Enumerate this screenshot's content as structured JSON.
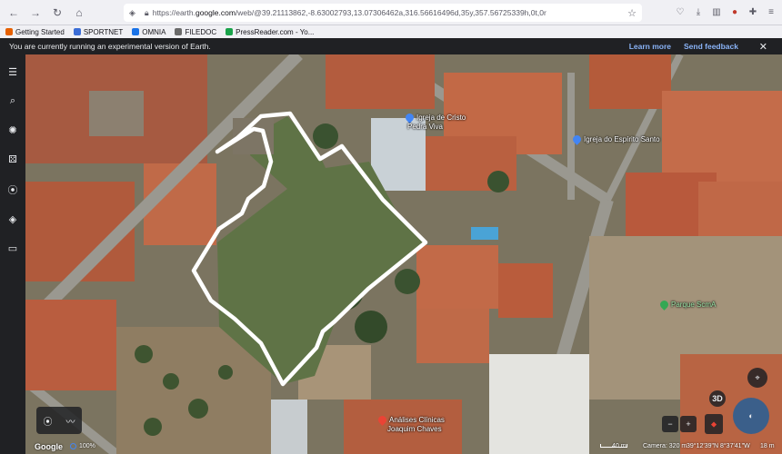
{
  "browser": {
    "url_prefix": "https://earth.",
    "url_host": "google.com",
    "url_rest": "/web/@39.21113862,-8.63002793,13.07306462a,316.56616496d,35y,357.56725339h,0t,0r",
    "bookmarks": [
      {
        "label": "Getting Started",
        "color": "#e66000"
      },
      {
        "label": "SPORTNET",
        "color": "#3b6dd6"
      },
      {
        "label": "OMNIA",
        "color": "#1a73e8"
      },
      {
        "label": "FILEDOC",
        "color": "#6a6a6a"
      },
      {
        "label": "PressReader.com - Yo...",
        "color": "#1aa34a"
      }
    ]
  },
  "banner": {
    "message": "You are currently running an experimental version of Earth.",
    "learn_more": "Learn more",
    "send_feedback": "Send feedback"
  },
  "sidebar": {
    "icons": [
      "menu-icon",
      "search-icon",
      "voyager-icon",
      "dice-icon",
      "pin-icon",
      "layers-icon",
      "ruler-icon"
    ]
  },
  "map": {
    "labels": [
      {
        "text": "Igreja de Cristo",
        "kind": "place"
      },
      {
        "text": "Pedra Viva",
        "kind": "place"
      },
      {
        "text": "Igreja do Espírito Santo",
        "kind": "place"
      },
      {
        "text": "Parque ScmA",
        "kind": "park"
      },
      {
        "text": "Análises Clínicas",
        "kind": "health"
      },
      {
        "text": "Joaquim Chaves",
        "kind": "health"
      }
    ]
  },
  "status": {
    "logo": "Google",
    "zoom": "100%",
    "scale": "40 m",
    "camera": "Camera: 320 m",
    "coords": "39°12'39\"N 8°37'41\"W",
    "elevation": "18 m"
  },
  "controls": {
    "three_d": "3D",
    "zoom_out": "−",
    "zoom_in": "+"
  },
  "colors": {
    "outline": "#ffffff",
    "roof": "#b8553a",
    "field": "#5f7346",
    "accent_link": "#8ab4f8"
  }
}
